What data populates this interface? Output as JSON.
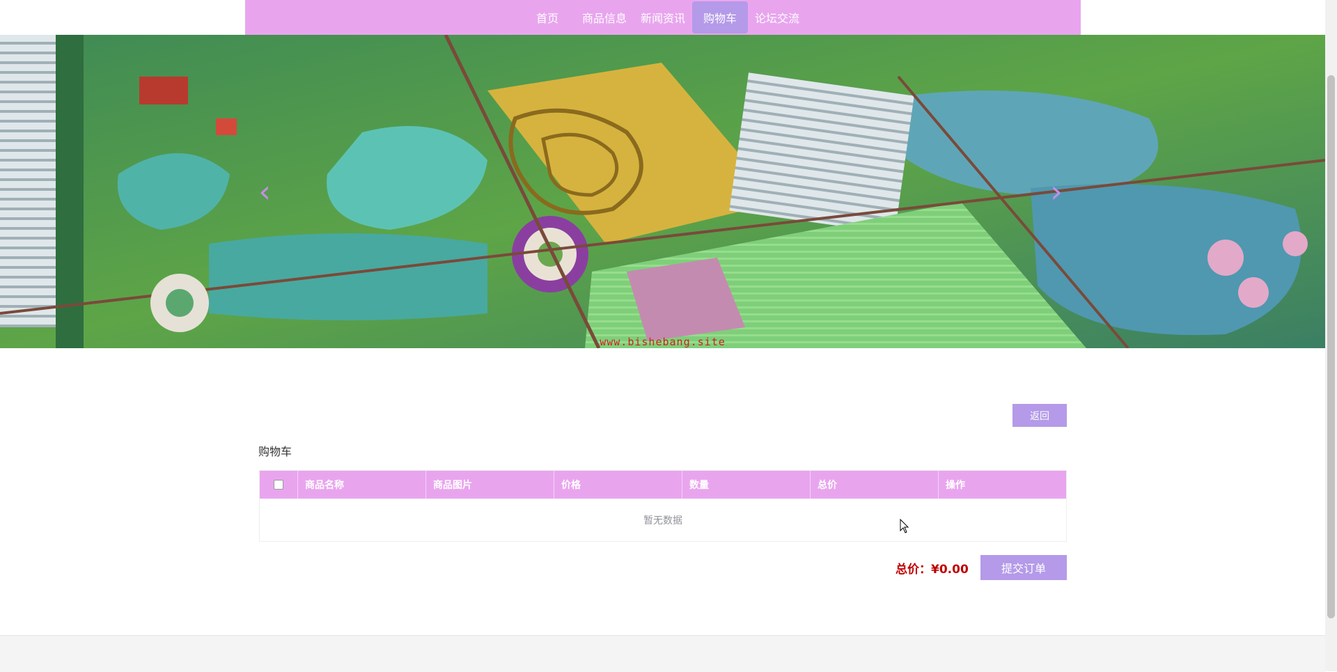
{
  "nav": {
    "items": [
      {
        "label": "首页",
        "active": false
      },
      {
        "label": "商品信息",
        "active": false
      },
      {
        "label": "新闻资讯",
        "active": false
      },
      {
        "label": "购物车",
        "active": true
      },
      {
        "label": "论坛交流",
        "active": false
      }
    ]
  },
  "banner": {
    "watermark": "www.bishebang.site",
    "prev_icon": "chevron-left-icon",
    "next_icon": "chevron-right-icon"
  },
  "content": {
    "back_label": "返回",
    "title": "购物车",
    "table": {
      "headers": [
        "商品名称",
        "商品图片",
        "价格",
        "数量",
        "总价",
        "操作"
      ],
      "empty_text": "暂无数据"
    },
    "total_label": "总价：",
    "total_value": "¥0.00",
    "submit_label": "提交订单"
  },
  "colors": {
    "nav_bg": "#e8a5ee",
    "button": "#b49ae8",
    "price": "#c00000"
  }
}
